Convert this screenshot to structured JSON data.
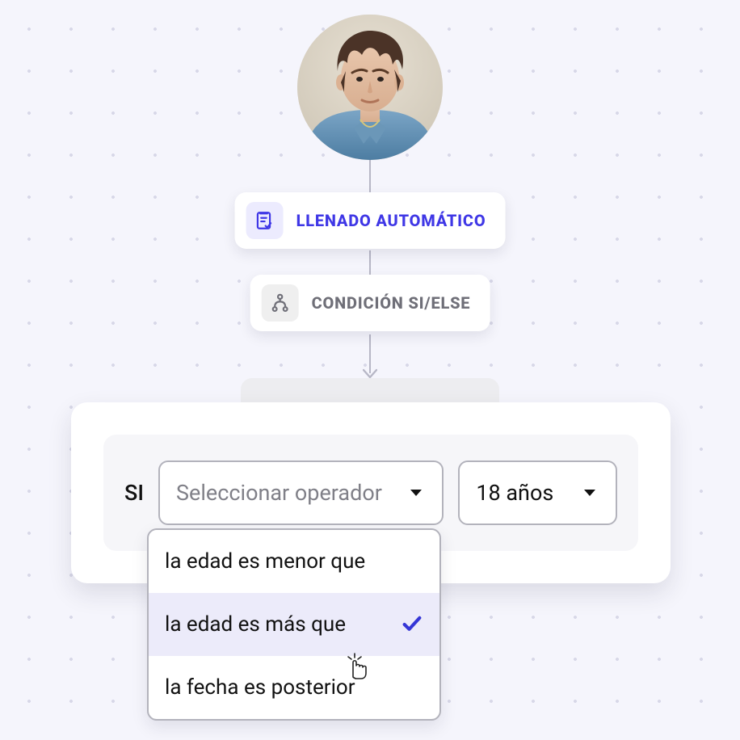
{
  "avatar": {
    "alt": "user photo"
  },
  "flow": {
    "autofill": {
      "label": "LLENADO AUTOMÁTICO",
      "icon": "form-check-icon"
    },
    "condition": {
      "label": "CONDICIÓN SI/ELSE",
      "icon": "branch-icon"
    }
  },
  "builder": {
    "si_label": "SI",
    "operator_placeholder": "Seleccionar operador",
    "value_selected": "18 años"
  },
  "dropdown": {
    "options": [
      {
        "label": "la edad es menor que",
        "selected": false
      },
      {
        "label": "la edad es más que",
        "selected": true
      },
      {
        "label": "la fecha es posterior",
        "selected": false
      }
    ]
  },
  "colors": {
    "accent": "#3f37e6"
  }
}
